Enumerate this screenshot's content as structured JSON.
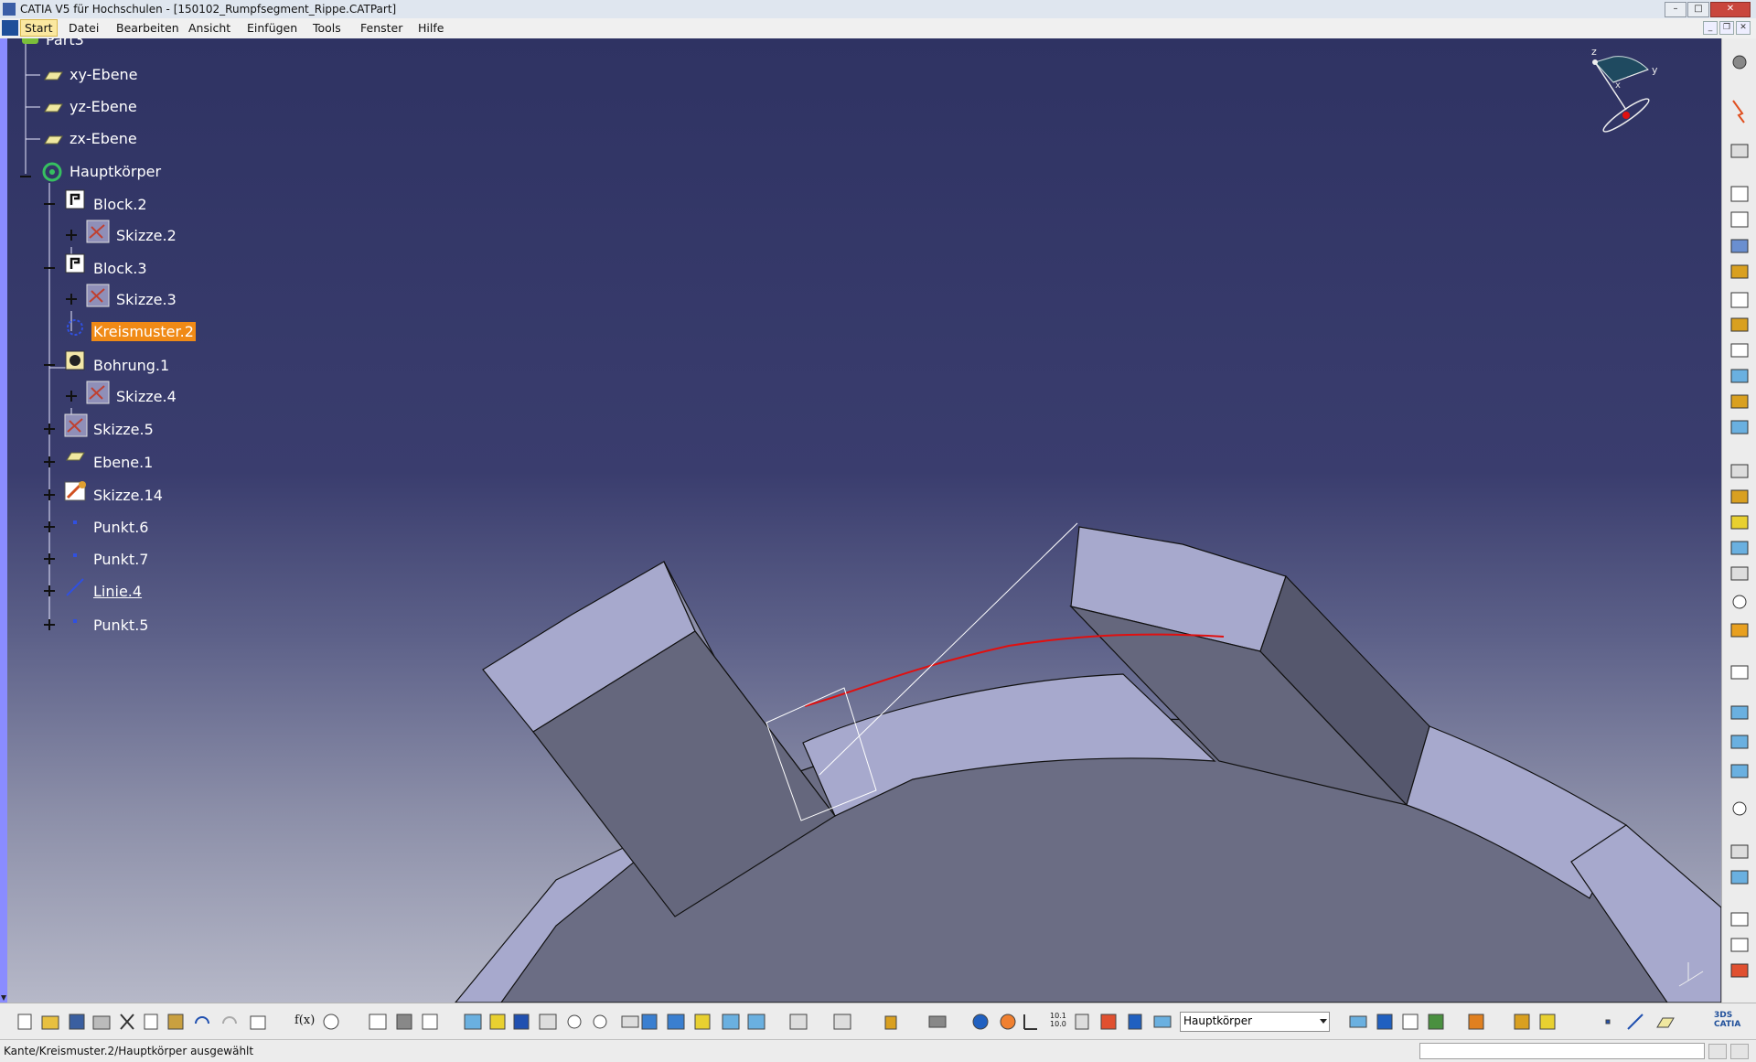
{
  "window": {
    "title": "CATIA V5 für Hochschulen - [150102_Rumpfsegment_Rippe.CATPart]",
    "controls": [
      "–",
      "□",
      "✕"
    ]
  },
  "menu": {
    "items": [
      "Start",
      "Datei",
      "Bearbeiten",
      "Ansicht",
      "Einfügen",
      "Tools",
      "Fenster",
      "Hilfe"
    ]
  },
  "tree": {
    "root": "Part3",
    "nodes": [
      {
        "label": "xy-Ebene",
        "icon": "plane-icon"
      },
      {
        "label": "yz-Ebene",
        "icon": "plane-icon"
      },
      {
        "label": "zx-Ebene",
        "icon": "plane-icon"
      },
      {
        "label": "Hauptkörper",
        "icon": "body-icon"
      },
      {
        "label": "Block.2",
        "icon": "pad-icon"
      },
      {
        "label": "Skizze.2",
        "icon": "sketch-icon"
      },
      {
        "label": "Block.3",
        "icon": "pad-icon"
      },
      {
        "label": "Skizze.3",
        "icon": "sketch-icon"
      },
      {
        "label": "Kreismuster.2",
        "icon": "circular-pattern-icon"
      },
      {
        "label": "Bohrung.1",
        "icon": "hole-icon"
      },
      {
        "label": "Skizze.4",
        "icon": "sketch-icon"
      },
      {
        "label": "Skizze.5",
        "icon": "sketch-icon"
      },
      {
        "label": "Ebene.1",
        "icon": "plane-icon"
      },
      {
        "label": "Skizze.14",
        "icon": "sketch-icon"
      },
      {
        "label": "Punkt.6",
        "icon": "point-icon"
      },
      {
        "label": "Punkt.7",
        "icon": "point-icon"
      },
      {
        "label": "Linie.4",
        "icon": "line-icon"
      },
      {
        "label": "Punkt.5",
        "icon": "point-icon"
      }
    ]
  },
  "compass": {
    "x": "x",
    "y": "y",
    "z": "z"
  },
  "toolbar": {
    "current_body": "Hauptkörper",
    "formula_label": "f(x)",
    "measure_label": "10.1 10.0"
  },
  "status": {
    "message": "Kante/Kreismuster.2/Hauptkörper ausgewählt",
    "command_input": ""
  },
  "colors": {
    "background_top": "#2f3363",
    "background_bottom": "#b6b8c8",
    "part_face_light": "#a7a9cd",
    "part_face_dark": "#65677d",
    "selection": "#f08a16",
    "highlight_edge": "#e01010"
  }
}
